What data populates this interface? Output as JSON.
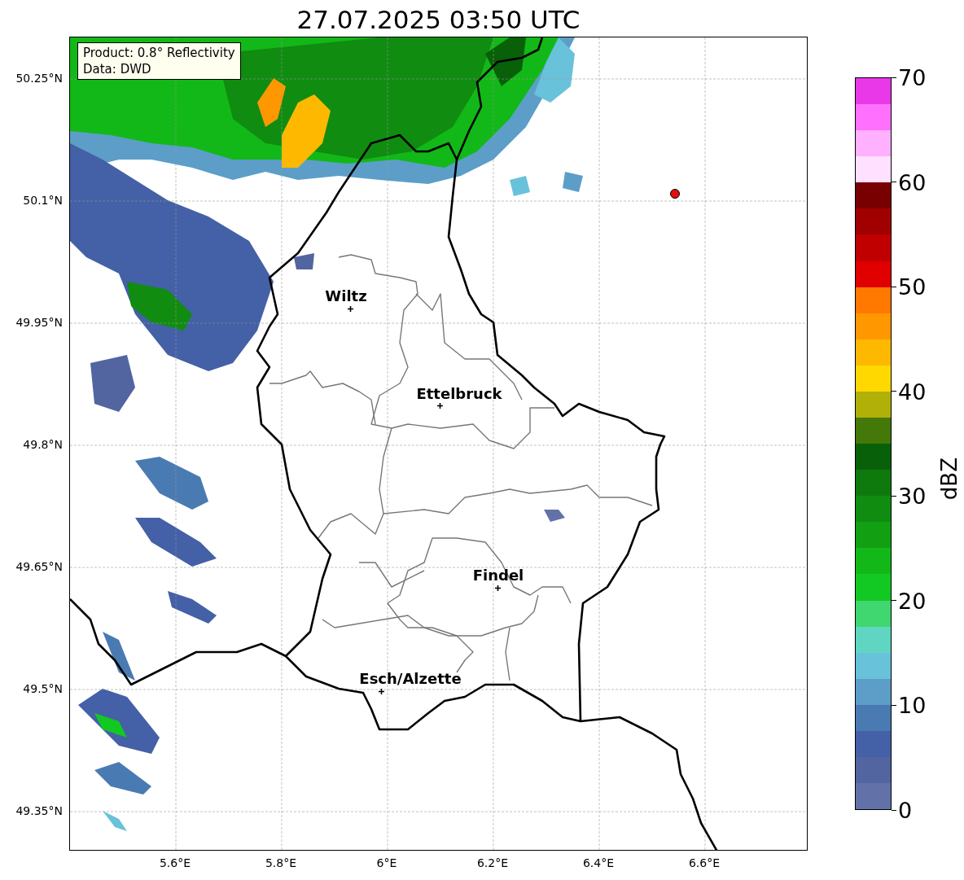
{
  "title": "27.07.2025 03:50 UTC",
  "info_box": [
    "Product: 0.8° Reflectivity",
    "Data: DWD"
  ],
  "lat_labels": [
    "50.25°N",
    "50.1°N",
    "49.95°N",
    "49.8°N",
    "49.65°N",
    "49.5°N",
    "49.35°N"
  ],
  "lon_labels": [
    "5.6°E",
    "5.8°E",
    "6°E",
    "6.2°E",
    "6.4°E",
    "6.6°E"
  ],
  "cities": [
    "Wiltz",
    "Ettelbruck",
    "Findel",
    "Esch/Alzette"
  ],
  "colorbar": {
    "label": "dBZ",
    "ticks": [
      "70",
      "60",
      "50",
      "40",
      "30",
      "20",
      "10",
      "0"
    ],
    "segments": [
      {
        "color": "#e838e8"
      },
      {
        "color": "#ff70ff"
      },
      {
        "color": "#ffb0ff"
      },
      {
        "color": "#ffe0ff"
      },
      {
        "color": "#780000"
      },
      {
        "color": "#a00000"
      },
      {
        "color": "#c00000"
      },
      {
        "color": "#e00000"
      },
      {
        "color": "#ff7800"
      },
      {
        "color": "#ff9800"
      },
      {
        "color": "#ffb800"
      },
      {
        "color": "#ffd800"
      },
      {
        "color": "#b0b008"
      },
      {
        "color": "#447808"
      },
      {
        "color": "#086008"
      },
      {
        "color": "#0e7a0e"
      },
      {
        "color": "#108c10"
      },
      {
        "color": "#12a012"
      },
      {
        "color": "#12b818"
      },
      {
        "color": "#12c822"
      },
      {
        "color": "#40d670"
      },
      {
        "color": "#60d6c2"
      },
      {
        "color": "#68c2da"
      },
      {
        "color": "#5c9ec8"
      },
      {
        "color": "#4a7ab2"
      },
      {
        "color": "#4460a6"
      },
      {
        "color": "#5265a0"
      },
      {
        "color": "#6272a8"
      }
    ]
  }
}
